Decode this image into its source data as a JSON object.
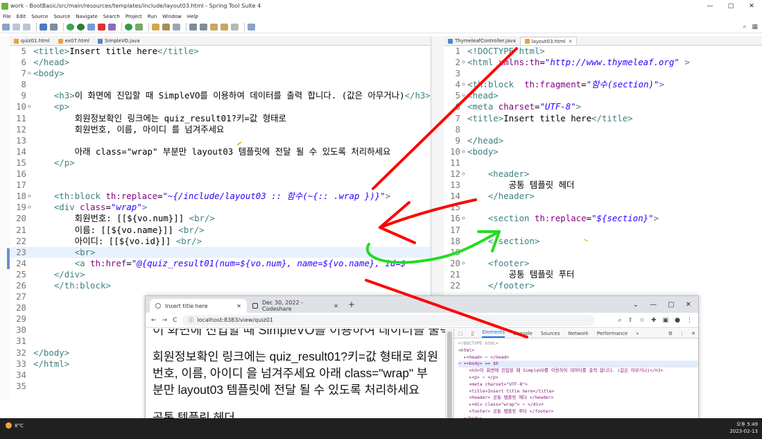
{
  "window": {
    "title": "work - BootBasic/src/main/resources/templates/include/layout03.html - Spring Tool Suite 4",
    "controls": [
      "—",
      "▢",
      "✕"
    ]
  },
  "menu": [
    "File",
    "Edit",
    "Source",
    "Source",
    "Navigate",
    "Search",
    "Project",
    "Run",
    "Window",
    "Help"
  ],
  "left_editor": {
    "tabs": [
      {
        "label": "quiz01.html",
        "active": false
      },
      {
        "label": "ex07.html",
        "active": false
      },
      {
        "label": "SimpleVO.java",
        "active": false
      }
    ],
    "lines": [
      {
        "n": "5",
        "g": "",
        "code": [
          [
            "tag",
            "<title>"
          ],
          [
            "txt",
            "Insert title here"
          ],
          [
            "tag",
            "</title>"
          ]
        ]
      },
      {
        "n": "6",
        "g": "",
        "code": [
          [
            "tag",
            "</head>"
          ]
        ]
      },
      {
        "n": "7",
        "g": "⊖",
        "code": [
          [
            "tag",
            "<body>"
          ]
        ]
      },
      {
        "n": "8",
        "g": "",
        "code": []
      },
      {
        "n": "9",
        "g": "",
        "code": [
          [
            "txt",
            "    "
          ],
          [
            "tag",
            "<h3>"
          ],
          [
            "txt",
            "이 화면에 진입할 때 SimpleVO를 이용하여 데이터를 출력 합니다. (값은 아무거나)"
          ],
          [
            "tag",
            "</h3>"
          ]
        ]
      },
      {
        "n": "10",
        "g": "⊖",
        "code": [
          [
            "txt",
            "    "
          ],
          [
            "tag",
            "<p>"
          ]
        ]
      },
      {
        "n": "11",
        "g": "",
        "code": [
          [
            "txt",
            "        회원정보확인 링크에는 quiz_result01?키=값 형태로"
          ]
        ]
      },
      {
        "n": "12",
        "g": "",
        "code": [
          [
            "txt",
            "        회원번호, 이름, 아이디 를 넘겨주세요"
          ]
        ]
      },
      {
        "n": "13",
        "g": "",
        "code": []
      },
      {
        "n": "14",
        "g": "",
        "code": [
          [
            "txt",
            "        아래 class=\"wrap\" 부분만 layout03 템플릿에 전달 될 수 있도록 처리하세요"
          ]
        ]
      },
      {
        "n": "15",
        "g": "",
        "code": [
          [
            "txt",
            "    "
          ],
          [
            "tag",
            "</p>"
          ]
        ]
      },
      {
        "n": "16",
        "g": "",
        "code": []
      },
      {
        "n": "17",
        "g": "",
        "code": []
      },
      {
        "n": "18",
        "g": "⊖",
        "code": [
          [
            "txt",
            "    "
          ],
          [
            "tag",
            "<th:block "
          ],
          [
            "attr",
            "th:replace"
          ],
          [
            "txt",
            "="
          ],
          [
            "str",
            "\"~{/include/layout03 :: 함수(~{:: .wrap })}\""
          ],
          [
            "tag",
            ">"
          ]
        ]
      },
      {
        "n": "19",
        "g": "⊖",
        "code": [
          [
            "txt",
            "    "
          ],
          [
            "tag",
            "<div "
          ],
          [
            "attr",
            "class"
          ],
          [
            "txt",
            "="
          ],
          [
            "str",
            "\"wrap\""
          ],
          [
            "tag",
            ">"
          ]
        ]
      },
      {
        "n": "20",
        "g": "",
        "code": [
          [
            "txt",
            "        회원번호: [[${vo.num}]] "
          ],
          [
            "tag",
            "<br/>"
          ]
        ]
      },
      {
        "n": "21",
        "g": "",
        "code": [
          [
            "txt",
            "        이름: [[${vo.name}]] "
          ],
          [
            "tag",
            "<br/>"
          ]
        ]
      },
      {
        "n": "22",
        "g": "",
        "code": [
          [
            "txt",
            "        아이디: [[${vo.id}]] "
          ],
          [
            "tag",
            "<br/>"
          ]
        ]
      },
      {
        "n": "23",
        "g": "",
        "code": [
          [
            "txt",
            "        "
          ],
          [
            "tag",
            "<br>"
          ]
        ],
        "current": true
      },
      {
        "n": "24",
        "g": "",
        "code": [
          [
            "txt",
            "        "
          ],
          [
            "tag",
            "<a "
          ],
          [
            "attr",
            "th:href"
          ],
          [
            "txt",
            "="
          ],
          [
            "str",
            "\"@{quiz_result01(num=${vo.num}, name=${vo.name}, id=$"
          ]
        ]
      },
      {
        "n": "25",
        "g": "",
        "code": [
          [
            "txt",
            "    "
          ],
          [
            "tag",
            "</div>"
          ]
        ]
      },
      {
        "n": "26",
        "g": "",
        "code": [
          [
            "txt",
            "    "
          ],
          [
            "tag",
            "</th:block>"
          ]
        ]
      },
      {
        "n": "27",
        "g": "",
        "code": []
      },
      {
        "n": "28",
        "g": "",
        "code": []
      },
      {
        "n": "29",
        "g": "",
        "code": []
      },
      {
        "n": "30",
        "g": "",
        "code": []
      },
      {
        "n": "31",
        "g": "",
        "code": []
      },
      {
        "n": "32",
        "g": "",
        "code": [
          [
            "tag",
            "</body>"
          ]
        ]
      },
      {
        "n": "33",
        "g": "",
        "code": [
          [
            "tag",
            "</html>"
          ]
        ]
      },
      {
        "n": "34",
        "g": "",
        "code": []
      },
      {
        "n": "35",
        "g": "",
        "code": []
      }
    ]
  },
  "right_editor": {
    "tabs": [
      {
        "label": "ThymeleafController.java",
        "active": false
      },
      {
        "label": "layout03.html",
        "active": true
      }
    ],
    "lines": [
      {
        "n": "1",
        "g": "",
        "code": [
          [
            "tag",
            "<!DOCTYPE html>"
          ]
        ]
      },
      {
        "n": "2",
        "g": "⊖",
        "code": [
          [
            "tag",
            "<html "
          ],
          [
            "attr",
            "xmlns:th"
          ],
          [
            "txt",
            "="
          ],
          [
            "str",
            "\"http://www.thymeleaf.org\""
          ],
          [
            "tag",
            " >"
          ]
        ]
      },
      {
        "n": "3",
        "g": "",
        "code": []
      },
      {
        "n": "4",
        "g": "⊖",
        "code": [
          [
            "tag",
            "<th:block  "
          ],
          [
            "attr",
            "th:fragment"
          ],
          [
            "txt",
            "="
          ],
          [
            "str",
            "\"함수(section)\""
          ],
          [
            "tag",
            ">"
          ]
        ]
      },
      {
        "n": "5",
        "g": "⊖",
        "code": [
          [
            "tag",
            "<head>"
          ]
        ]
      },
      {
        "n": "6",
        "g": "",
        "code": [
          [
            "tag",
            "<meta "
          ],
          [
            "attr",
            "charset"
          ],
          [
            "txt",
            "="
          ],
          [
            "str",
            "\"UTF-8\""
          ],
          [
            "tag",
            ">"
          ]
        ]
      },
      {
        "n": "7",
        "g": "",
        "code": [
          [
            "tag",
            "<title>"
          ],
          [
            "txt",
            "Insert title here"
          ],
          [
            "tag",
            "</title>"
          ]
        ]
      },
      {
        "n": "8",
        "g": "",
        "code": []
      },
      {
        "n": "9",
        "g": "",
        "code": [
          [
            "tag",
            "</head>"
          ]
        ]
      },
      {
        "n": "10",
        "g": "⊖",
        "code": [
          [
            "tag",
            "<body>"
          ]
        ]
      },
      {
        "n": "11",
        "g": "",
        "code": []
      },
      {
        "n": "12",
        "g": "⊖",
        "code": [
          [
            "txt",
            "    "
          ],
          [
            "tag",
            "<header>"
          ]
        ]
      },
      {
        "n": "13",
        "g": "",
        "code": [
          [
            "txt",
            "        공통 템플릿 헤더"
          ]
        ]
      },
      {
        "n": "14",
        "g": "",
        "code": [
          [
            "txt",
            "    "
          ],
          [
            "tag",
            "</header>"
          ]
        ]
      },
      {
        "n": "15",
        "g": "",
        "code": []
      },
      {
        "n": "16",
        "g": "⊖",
        "code": [
          [
            "txt",
            "    "
          ],
          [
            "tag",
            "<section "
          ],
          [
            "attr",
            "th:replace"
          ],
          [
            "txt",
            "="
          ],
          [
            "str",
            "\"${section}\""
          ],
          [
            "tag",
            ">"
          ]
        ]
      },
      {
        "n": "17",
        "g": "",
        "code": []
      },
      {
        "n": "18",
        "g": "",
        "code": [
          [
            "txt",
            "    "
          ],
          [
            "tag",
            "</section>"
          ]
        ]
      },
      {
        "n": "19",
        "g": "",
        "code": []
      },
      {
        "n": "20",
        "g": "⊖",
        "code": [
          [
            "txt",
            "    "
          ],
          [
            "tag",
            "<footer>"
          ]
        ]
      },
      {
        "n": "21",
        "g": "",
        "code": [
          [
            "txt",
            "        공통 템플릿 푸터"
          ]
        ]
      },
      {
        "n": "22",
        "g": "",
        "code": [
          [
            "txt",
            "    "
          ],
          [
            "tag",
            "</footer>"
          ]
        ]
      }
    ]
  },
  "browser": {
    "tabs": [
      {
        "label": "Insert title here",
        "active": true
      },
      {
        "label": "Dec 30, 2022 - Codeshare",
        "active": false
      }
    ],
    "new_tab": "+",
    "url": "localhost:8383/view/quiz01",
    "nav": {
      "back": "←",
      "forward": "→",
      "reload": "C"
    },
    "page": {
      "cut_heading": "이 화면에 진입할 때 SimpleVO를 이용하여 데이터를 출력 합니다. (값은 아무거나)",
      "paragraph": "회원정보확인 링크에는 quiz_result01?키=값 형태로 회원번호, 이름, 아이디 을 넘겨주세요 아래 class=\"wrap\" 부분만 layout03 템플릿에 전달 될 수 있도록 처리하세요",
      "next_heading": "공통 템플릿 헤더"
    },
    "devtools": {
      "tabs": [
        "Elements",
        "Console",
        "Sources",
        "Network",
        "Performance"
      ],
      "more": "»",
      "lines": [
        {
          "indent": 0,
          "html": "<!DOCTYPE html>",
          "kind": "c"
        },
        {
          "indent": 0,
          "html": "<html>",
          "kind": "t"
        },
        {
          "indent": 1,
          "html": "▸<head> ⋯ </head>",
          "kind": "t"
        },
        {
          "indent": 0,
          "html": "⋯ ▾<body> == $0",
          "kind": "t",
          "selected": true
        },
        {
          "indent": 2,
          "html": "<h3>이 화면에 진입할 때 SimpleVO를 이용하여 데이터를 출력 합니다. (값은 아무거나)</h3>",
          "kind": "t"
        },
        {
          "indent": 2,
          "html": "▸<p> ⋯ </p>",
          "kind": "t"
        },
        {
          "indent": 2,
          "html": "<meta charset=\"UTF-8\">",
          "kind": "t"
        },
        {
          "indent": 2,
          "html": "<title>Insert title here</title>",
          "kind": "t"
        },
        {
          "indent": 2,
          "html": "<header> 공통 템플릿 헤더 </header>",
          "kind": "t"
        },
        {
          "indent": 2,
          "html": "▸<div class=\"wrap\"> ⋯ </div>",
          "kind": "t"
        },
        {
          "indent": 2,
          "html": "<footer> 공통 템플릿 푸터 </footer>",
          "kind": "t"
        },
        {
          "indent": 1,
          "html": "</body>",
          "kind": "t"
        },
        {
          "indent": 0,
          "html": "</html>",
          "kind": "t"
        }
      ]
    }
  },
  "taskbar": {
    "weather": "8°C",
    "time": "오후 5:49",
    "date": "2023-02-13"
  },
  "colors": {
    "tag": "#3f7f7f",
    "attr": "#7f007f",
    "string": "#2a00ff",
    "annotation_red": "#ff0000",
    "annotation_green": "#22dd22"
  }
}
